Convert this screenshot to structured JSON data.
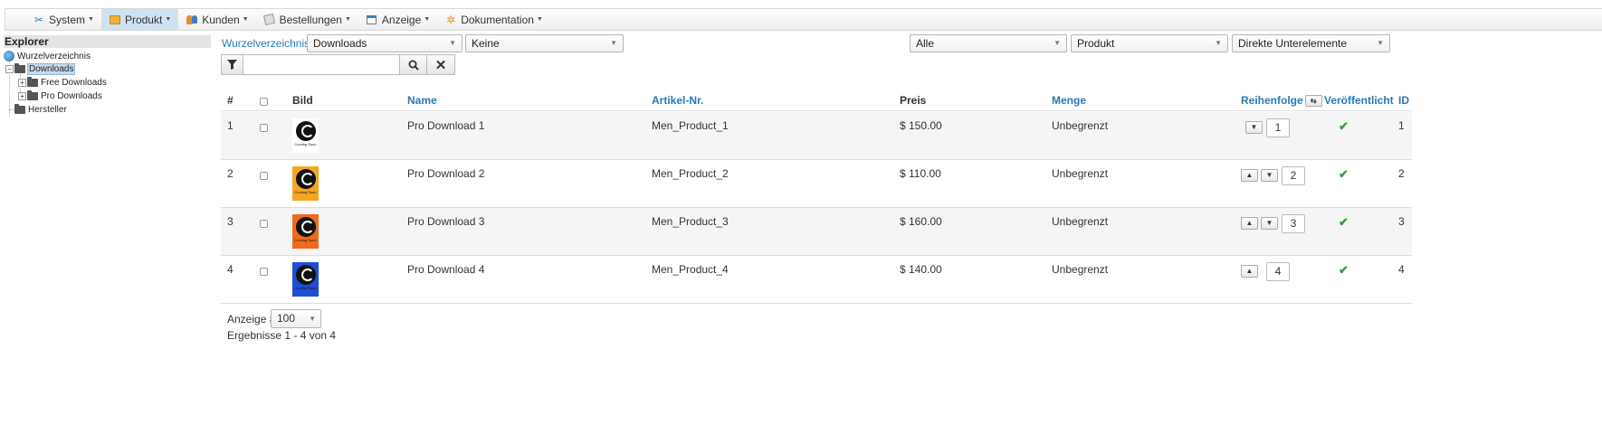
{
  "menu": [
    {
      "label": "System",
      "icon": "tools-icon",
      "active": false
    },
    {
      "label": "Produkt",
      "icon": "box-icon",
      "active": true
    },
    {
      "label": "Kunden",
      "icon": "users-icon",
      "active": false
    },
    {
      "label": "Bestellungen",
      "icon": "orders-icon",
      "active": false
    },
    {
      "label": "Anzeige",
      "icon": "display-icon",
      "active": false
    },
    {
      "label": "Dokumentation",
      "icon": "docs-icon",
      "active": false
    }
  ],
  "explorer": {
    "title": "Explorer",
    "root": "Wurzelverzeichnis",
    "downloads": "Downloads",
    "free": "Free Downloads",
    "pro": "Pro Downloads",
    "manufacturer": "Hersteller"
  },
  "filters": {
    "breadcrumb": "Wurzelverzeichnis/",
    "folder_select": "Downloads",
    "second_select": "Keine",
    "status_select": "Alle",
    "type_select": "Produkt",
    "scope_select": "Direkte Unterelemente",
    "search_value": ""
  },
  "table": {
    "headers": {
      "num": "#",
      "image": "Bild",
      "name": "Name",
      "sku": "Artikel-Nr.",
      "price": "Preis",
      "quantity": "Menge",
      "order": "Reihenfolge",
      "published": "Veröffentlicht",
      "id": "ID"
    },
    "rows": [
      {
        "num": "1",
        "name": "Pro Download 1",
        "sku": "Men_Product_1",
        "price": "$ 150.00",
        "quantity": "Unbegrenzt",
        "order": "1",
        "id": "1",
        "thumb_color": "#ffffff",
        "thumb_caption": "Coming Soon",
        "published": true
      },
      {
        "num": "2",
        "name": "Pro Download 2",
        "sku": "Men_Product_2",
        "price": "$ 110.00",
        "quantity": "Unbegrenzt",
        "order": "2",
        "id": "2",
        "thumb_color": "#f5a623",
        "thumb_caption": "Coming Soon",
        "published": true
      },
      {
        "num": "3",
        "name": "Pro Download 3",
        "sku": "Men_Product_3",
        "price": "$ 160.00",
        "quantity": "Unbegrenzt",
        "order": "3",
        "id": "3",
        "thumb_color": "#f06a1e",
        "thumb_caption": "Coming Soon",
        "published": true
      },
      {
        "num": "4",
        "name": "Pro Download 4",
        "sku": "Men_Product_4",
        "price": "$ 140.00",
        "quantity": "Unbegrenzt",
        "order": "4",
        "id": "4",
        "thumb_color": "#1d4fd6",
        "thumb_caption": "Coming Soon",
        "published": true
      }
    ]
  },
  "footer": {
    "limit_label": "Anzeige #",
    "limit_value": "100",
    "results": "Ergebnisse 1 - 4 von 4"
  },
  "colors": {
    "link": "#2a7ab8",
    "check": "#3c9a3c",
    "active_menu": "#cfe2f2"
  }
}
